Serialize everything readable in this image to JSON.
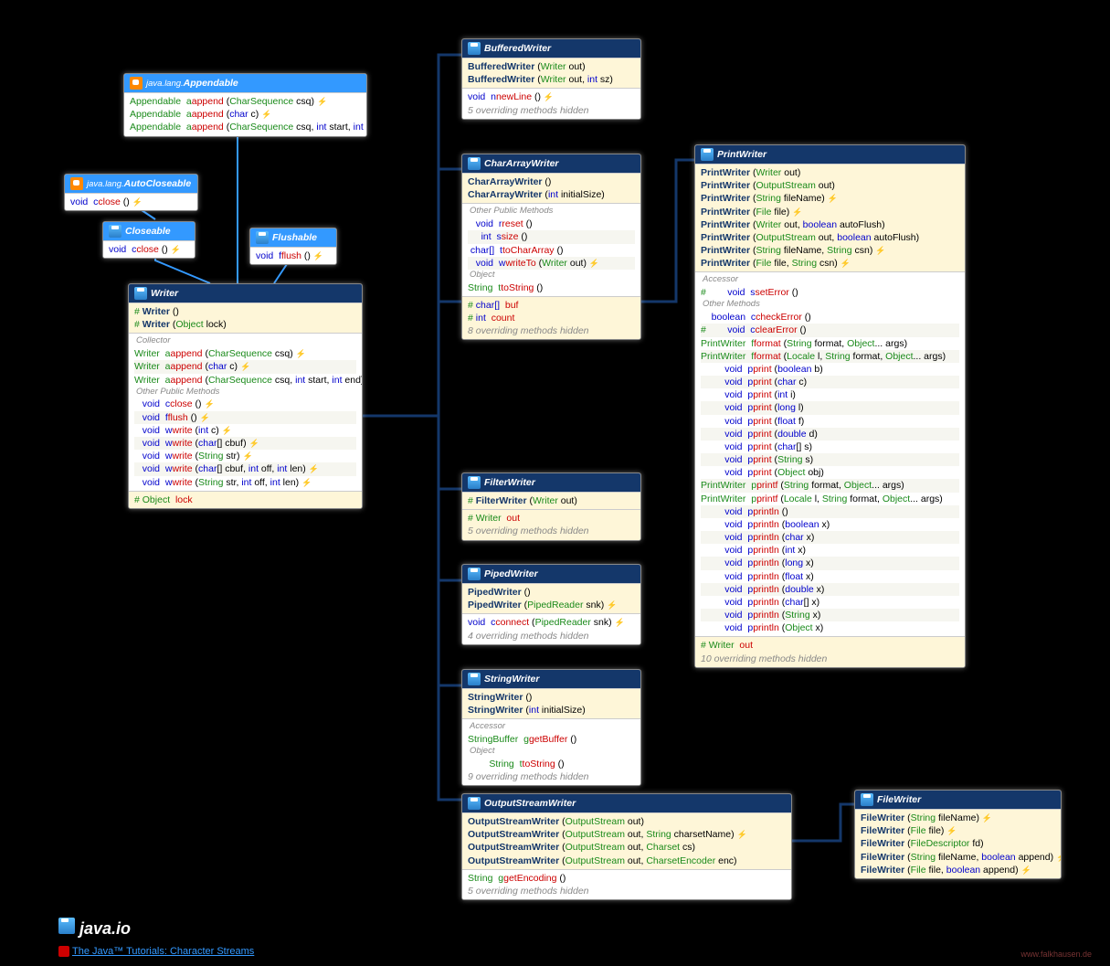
{
  "package": "java.io",
  "tutorial_link_text": "The Java™ Tutorials: Character Streams",
  "credit": "www.falkhausen.de",
  "interfaces": {
    "appendable": {
      "pkg": "java.lang.",
      "name": "Appendable",
      "methods": [
        "Appendable  append (CharSequence csq) ⚡",
        "Appendable  append (char c) ⚡",
        "Appendable  append (CharSequence csq, int start, int end) ⚡"
      ]
    },
    "autocloseable": {
      "pkg": "java.lang.",
      "name": "AutoCloseable",
      "methods": [
        "void  close () ⚡"
      ]
    },
    "closeable": {
      "name": "Closeable",
      "methods": [
        "void  close () ⚡"
      ]
    },
    "flushable": {
      "name": "Flushable",
      "methods": [
        "void  flush () ⚡"
      ]
    }
  },
  "classes": {
    "writer": {
      "name": "Writer",
      "constructors": [
        "# Writer ()",
        "# Writer (Object lock)"
      ],
      "group1_label": "Collector",
      "group1": [
        "Writer  append (CharSequence csq) ⚡",
        "Writer  append (char c) ⚡",
        "Writer  append (CharSequence csq, int start, int end) ⚡"
      ],
      "group2_label": "Other Public Methods",
      "group2": [
        "   void  close () ⚡",
        "   void  flush () ⚡",
        "   void  write (int c) ⚡",
        "   void  write (char[] cbuf) ⚡",
        "   void  write (String str) ⚡",
        "   void  write (char[] cbuf, int off, int len) ⚡",
        "   void  write (String str, int off, int len) ⚡"
      ],
      "fields": [
        "# Object  lock"
      ]
    },
    "bufferedwriter": {
      "name": "BufferedWriter",
      "constructors": [
        "BufferedWriter (Writer out)",
        "BufferedWriter (Writer out, int sz)"
      ],
      "methods": [
        "void  newLine () ⚡"
      ],
      "hidden": "5 overriding methods hidden"
    },
    "chararraywriter": {
      "name": "CharArrayWriter",
      "constructors": [
        "CharArrayWriter ()",
        "CharArrayWriter (int initialSize)"
      ],
      "group_label": "Other Public Methods",
      "methods": [
        "   void  reset ()",
        "     int  size ()",
        " char[]  toCharArray ()",
        "   void  writeTo (Writer out) ⚡"
      ],
      "object_label": "Object",
      "object_methods": [
        "String  toString ()"
      ],
      "fields": [
        "# char[]  buf",
        "# int  count"
      ],
      "hidden": "8 overriding methods hidden"
    },
    "filterwriter": {
      "name": "FilterWriter",
      "constructors": [
        "# FilterWriter (Writer out)"
      ],
      "fields": [
        "# Writer  out"
      ],
      "hidden": "5 overriding methods hidden"
    },
    "pipedwriter": {
      "name": "PipedWriter",
      "constructors": [
        "PipedWriter ()",
        "PipedWriter (PipedReader snk) ⚡"
      ],
      "methods": [
        "void  connect (PipedReader snk) ⚡"
      ],
      "hidden": "4 overriding methods hidden"
    },
    "stringwriter": {
      "name": "StringWriter",
      "constructors": [
        "StringWriter ()",
        "StringWriter (int initialSize)"
      ],
      "accessor_label": "Accessor",
      "accessors": [
        "StringBuffer  getBuffer ()"
      ],
      "object_label": "Object",
      "object_methods": [
        "        String  toString ()"
      ],
      "hidden": "9 overriding methods hidden"
    },
    "outputstreamwriter": {
      "name": "OutputStreamWriter",
      "constructors": [
        "OutputStreamWriter (OutputStream out)",
        "OutputStreamWriter (OutputStream out, String charsetName) ⚡",
        "OutputStreamWriter (OutputStream out, Charset cs)",
        "OutputStreamWriter (OutputStream out, CharsetEncoder enc)"
      ],
      "methods": [
        "String  getEncoding ()"
      ],
      "hidden": "5 overriding methods hidden"
    },
    "filewriter": {
      "name": "FileWriter",
      "constructors": [
        "FileWriter (String fileName) ⚡",
        "FileWriter (File file) ⚡",
        "FileWriter (FileDescriptor fd)",
        "FileWriter (String fileName, boolean append) ⚡",
        "FileWriter (File file, boolean append) ⚡"
      ]
    },
    "printwriter": {
      "name": "PrintWriter",
      "constructors": [
        "PrintWriter (Writer out)",
        "PrintWriter (OutputStream out)",
        "PrintWriter (String fileName) ⚡",
        "PrintWriter (File file) ⚡",
        "PrintWriter (Writer out, boolean autoFlush)",
        "PrintWriter (OutputStream out, boolean autoFlush)",
        "PrintWriter (String fileName, String csn) ⚡",
        "PrintWriter (File file, String csn) ⚡"
      ],
      "accessor_label": "Accessor",
      "accessors": [
        "#        void  setError ()"
      ],
      "other_label": "Other Methods",
      "methods": [
        "    boolean  checkError ()",
        "#        void  clearError ()",
        "PrintWriter  format (String format, Object... args)",
        "PrintWriter  format (Locale l, String format, Object... args)",
        "         void  print (boolean b)",
        "         void  print (char c)",
        "         void  print (int i)",
        "         void  print (long l)",
        "         void  print (float f)",
        "         void  print (double d)",
        "         void  print (char[] s)",
        "         void  print (String s)",
        "         void  print (Object obj)",
        "PrintWriter  printf (String format, Object... args)",
        "PrintWriter  printf (Locale l, String format, Object... args)",
        "         void  println ()",
        "         void  println (boolean x)",
        "         void  println (char x)",
        "         void  println (int x)",
        "         void  println (long x)",
        "         void  println (float x)",
        "         void  println (double x)",
        "         void  println (char[] x)",
        "         void  println (String x)",
        "         void  println (Object x)"
      ],
      "fields": [
        "# Writer  out"
      ],
      "hidden": "10 overriding methods hidden"
    }
  }
}
